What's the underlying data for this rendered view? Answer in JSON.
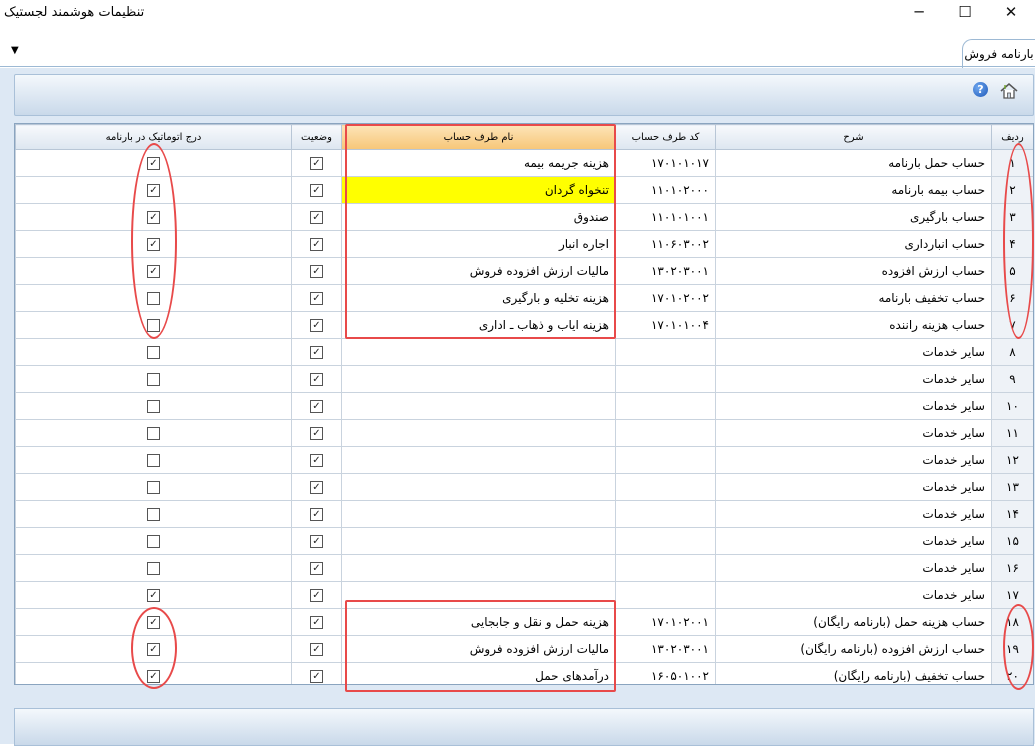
{
  "window": {
    "title": "تنظیمات هوشمند لجستیک",
    "min_glyph": "─",
    "max_glyph": "☐",
    "close_glyph": "✕"
  },
  "tabbar": {
    "dropdown_glyph": "▼",
    "tab_label": "بارنامه فروش"
  },
  "toolbar": {
    "help_glyph": "?",
    "icons": [
      "home-icon",
      "help-icon"
    ]
  },
  "grid": {
    "headers": {
      "row": "ردیف",
      "description": "شرح",
      "account_code": "کد طرف حساب",
      "account_name": "نام طرف حساب",
      "status": "وضعیت",
      "auto_insert": "درج اتوماتیک در بارنامه"
    },
    "highlight_color": "#ffff00",
    "rows": [
      {
        "num": "۱",
        "desc": "حساب حمل بارنامه",
        "code": "۱۷۰۱۰۱۰۱۷",
        "name": "هزینه جریمه بیمه",
        "status": true,
        "auto": true
      },
      {
        "num": "۲",
        "desc": "حساب بیمه بارنامه",
        "code": "۱۱۰۱۰۲۰۰۰",
        "name": "تنخواه گردان",
        "status": true,
        "auto": true,
        "selected": true
      },
      {
        "num": "۳",
        "desc": "حساب بارگیری",
        "code": "۱۱۰۱۰۱۰۰۱",
        "name": "صندوق",
        "status": true,
        "auto": true
      },
      {
        "num": "۴",
        "desc": "حساب انبارداری",
        "code": "۱۱۰۶۰۳۰۰۲",
        "name": "اجاره انبار",
        "status": true,
        "auto": true
      },
      {
        "num": "۵",
        "desc": "حساب ارزش افزوده",
        "code": "۱۳۰۲۰۳۰۰۱",
        "name": "مالیات ارزش افزوده فروش",
        "status": true,
        "auto": true
      },
      {
        "num": "۶",
        "desc": "حساب تخفیف بارنامه",
        "code": "۱۷۰۱۰۲۰۰۲",
        "name": "هزینه تخلیه و بارگیری",
        "status": true,
        "auto": false
      },
      {
        "num": "۷",
        "desc": "حساب هزینه راننده",
        "code": "۱۷۰۱۰۱۰۰۴",
        "name": "هزینه ایاب و ذهاب ـ اداری",
        "status": true,
        "auto": false
      },
      {
        "num": "۸",
        "desc": "سایر خدمات",
        "code": "",
        "name": "",
        "status": true,
        "auto": false
      },
      {
        "num": "۹",
        "desc": "سایر خدمات",
        "code": "",
        "name": "",
        "status": true,
        "auto": false
      },
      {
        "num": "۱۰",
        "desc": "سایر خدمات",
        "code": "",
        "name": "",
        "status": true,
        "auto": false
      },
      {
        "num": "۱۱",
        "desc": "سایر خدمات",
        "code": "",
        "name": "",
        "status": true,
        "auto": false
      },
      {
        "num": "۱۲",
        "desc": "سایر خدمات",
        "code": "",
        "name": "",
        "status": true,
        "auto": false
      },
      {
        "num": "۱۳",
        "desc": "سایر خدمات",
        "code": "",
        "name": "",
        "status": true,
        "auto": false
      },
      {
        "num": "۱۴",
        "desc": "سایر خدمات",
        "code": "",
        "name": "",
        "status": true,
        "auto": false
      },
      {
        "num": "۱۵",
        "desc": "سایر خدمات",
        "code": "",
        "name": "",
        "status": true,
        "auto": false
      },
      {
        "num": "۱۶",
        "desc": "سایر خدمات",
        "code": "",
        "name": "",
        "status": true,
        "auto": false
      },
      {
        "num": "۱۷",
        "desc": "سایر خدمات",
        "code": "",
        "name": "",
        "status": true,
        "auto": true
      },
      {
        "num": "۱۸",
        "desc": "حساب هزینه حمل (بارنامه رایگان)",
        "code": "۱۷۰۱۰۲۰۰۱",
        "name": "هزینه حمل و نقل و جابجایی",
        "status": true,
        "auto": true
      },
      {
        "num": "۱۹",
        "desc": "حساب ارزش افزوده (بارنامه رایگان)",
        "code": "۱۳۰۲۰۳۰۰۱",
        "name": "مالیات ارزش افزوده فروش",
        "status": true,
        "auto": true
      },
      {
        "num": "۲۰",
        "desc": "حساب تخفیف (بارنامه رایگان)",
        "code": "۱۶۰۵۰۱۰۰۲",
        "name": "درآمدهای حمل",
        "status": true,
        "auto": true
      }
    ]
  },
  "annotation_color": "#e84a4a"
}
